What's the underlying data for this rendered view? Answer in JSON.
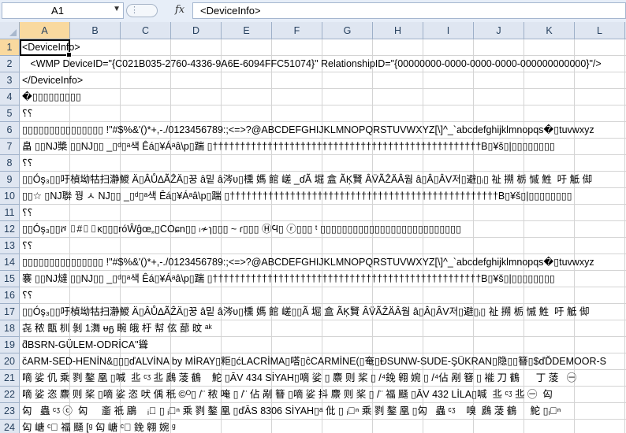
{
  "formula_bar": {
    "name_box": "A1",
    "formula": "<DeviceInfo>"
  },
  "columns": [
    "A",
    "B",
    "C",
    "D",
    "E",
    "F",
    "G",
    "H",
    "I",
    "J",
    "K",
    "L"
  ],
  "rows": [
    {
      "num": "1",
      "text": "<DeviceInfo>"
    },
    {
      "num": "2",
      "text": "   <WMP DeviceID=\"{C021B035-2760-4336-9A6E-6094FFC51074}\" RelationshipID=\"{00000000-0000-0000-0000-000000000000}\"/>"
    },
    {
      "num": "3",
      "text": "</DeviceInfo>"
    },
    {
      "num": "4",
      "text": "�▯▯▯▯▯▯▯▯▯"
    },
    {
      "num": "5",
      "text": "⸮⸮"
    },
    {
      "num": "6",
      "text": "▯▯▯▯▯▯▯▯▯▯▯▯▯▯▯ !\"#$%&'()*+,-./0123456789:;<=>?@ABCDEFGHIJKLMNOPQRSTUVWXYZ[\\]^_`abcdefghijklmnopqs�▯tuvwxyz"
    },
    {
      "num": "7",
      "text": "畠 ▯▯NJ槳 ▯▯NJ▯▯ _▯ᵈ▯ᵃ색 Êá▯¥Áᵃâ\\p▯踹 ▯†††††††††††††††††††††††††††††††††††††††††††††††††B▯¥š▯|▯▯▯▯▯▯▯▯"
    },
    {
      "num": "8",
      "text": "⸮⸮"
    },
    {
      "num": "9",
      "text": "▯▯Óş₃▯▯吁楨坳牯扫瀞鯼 Ä▯ÂŮ∆ÃẐÄ▯꿍 â밑 â涔ʋ▯櫄 媽 館 嵯 _ɗÃ 堀 盒 ÃĶ賢 ÂV̈ÃẐÄ̈Â웜 â▯Â▯ÂV저▯避▯ᵢ▯ 祉 搠 栃 慽 鮏  吁 觝 㑢"
    },
    {
      "num": "10",
      "text": "▯▯☆ ▯NJ聨 꿩 ㅅ NJ▯▯ _▯ᵈ▯ᵃ색 Êá▯¥Áᵃâ\\p▯踹 ▯†††††††††††††††††††††††††††††††††††††††††††††††††B▯¥š▯|▯▯▯▯▯▯▯▯"
    },
    {
      "num": "11",
      "text": "⸮⸮"
    },
    {
      "num": "12",
      "text": "▯▯Óş₃▯▯ሾ ▯#▯▯ĸ▯▯▯róŴĝœ„▯COɕn▯▯ ₗ≁ɿ▯▯▯ ~ ɾ▯▯▯ ⒽϤ▯ ⓡ▯▯▯ ᵗ ▯▯▯▯▯▯▯▯▯▯▯▯▯▯▯▯▯▯▯▯▯▯▯▯▯▯"
    },
    {
      "num": "13",
      "text": "⸮⸮"
    },
    {
      "num": "14",
      "text": "▯▯▯▯▯▯▯▯▯▯▯▯▯▯▯ !\"#$%&'()*+,-./0123456789:;<=>?@ABCDEFGHIJKLMNOPQRSTUVWXYZ[\\]^_`abcdefghijklmnopqs�▯tuvwxyz"
    },
    {
      "num": "15",
      "text": "褰 ▯▯NJ燵 ▯▯NJ▯▯ _▯ᵈ▯ᵃ색 Êá▯¥Áᵃâ\\p▯踹 ▯†††††††††††††††††††††††††††††††††††††††††††††††††B▯¥š▯|▯▯▯▯▯▯▯▯"
    },
    {
      "num": "16",
      "text": "⸮⸮"
    },
    {
      "num": "17",
      "text": "▯▯Óş₃▯▯吁楨坳牯扫瀞鯼 Ä▯ÂŮ∆ÃẐÄ▯꿍 â밑 â涔ʋ▯櫄 媽 館 嵯▯▯Ã 堀 盒 ÃĶ賢 ÂV̈ÃẐÄ̈Â웜 â▯Â▯ÂV저▯避▯ᵢ▯ 祉 搠 栃 慽 鮏  吁 觝 㑢"
    },
    {
      "num": "18",
      "text": "㐂 秾 甑 杊 剝 1㵲 ᵾᵷ 畹 皒 杅 幇 伭 蔀 旼 ᵃᵏ"
    },
    {
      "num": "19",
      "text": "ƌBSRN-GÜLEM-ODRİCA\"聳"
    },
    {
      "num": "20",
      "text": "čARM-SED-HENİN&▯▯▯ďALVİNA by MİRAY▯粔▯ćLACRİMA▯嗒▯ĉCARMİNE(▯奄▯ĐSUNW-SUDE-ŞÜKRAN▯隐▯▯簮▯$ďĎDEMOOR-S"
    },
    {
      "num": "21",
      "text": "嘀 娑 仉 乘 剹 鏊 凰 ▯喊  丠 ᶜᶾ 丠 鷉 蓤 鶴    鮀 ▯ĀV 434 SİYAH▯嘀 娑 ▯ 麖 则 桨 ▯ /⁴鋔 翱 婉 ▯ /⁴佔 剐 簮 ▯ 褦 刀 鶴      丁 蔆   ㊀"
    },
    {
      "num": "22",
      "text": "嘀 娑 恣 麖 则 桨 ▯嘀 娑 恣 吠 偊 秖 ©ᴼ▯ /¨ 秾 唵 ▯ /¨ 佔 剐 簮 ▯嘀 娑 抖 麖 则 桨 ▯ /¨ 福 颾 ▯ĀV 432 LİLA▯喊  丠 ᶜᶾ 丠 ㊀  匃"
    },
    {
      "num": "23",
      "text": "匃   蟲 ᶜᶾ ⓒ  匃     齑 祇 鶌    ᵢ᷎ ▯ ᵢ᷎ⁿ 乘 剹 鏊 凰 ▯ďĀS 8306 SİYAH▯ᵃ 仳 ▯ ᵢ᷎ⁿ 乘 剹 鏊 凰 ▯匃   蟲 ᶜᶾ    嗅  鷉 蓤 鶴     鮀 ▯ᵢ᷎ⁿ"
    },
    {
      "num": "24",
      "text": "匃 嵣 ᶜ᷎ 福 颾 [ᵍ 匃 嵣 ᶜ᷎ 鋔 翱 婉 ᵍ"
    },
    {
      "num": "25",
      "text": "匃 嵣 ⁿ᷎ ''䔬 ▯㣟 坤 乘 剹 鏊 凰 ▯簮 褦 刀 刀 蔆 鶴    嗧 鬓 唠 贼   謎 刀      ▯ANİŞANLIK KIRMIZI▯鮀 刀 蔆 鶴        币 鬓 ▯吁 祇 鷉 酩 鶴 ▯AG"
    }
  ]
}
